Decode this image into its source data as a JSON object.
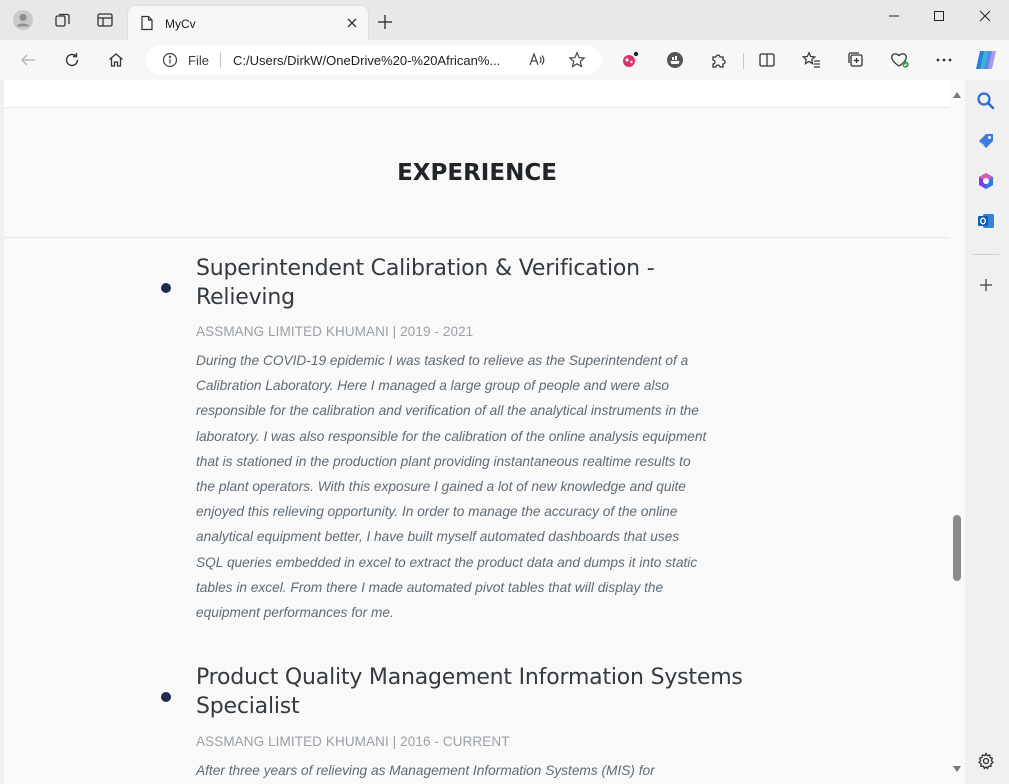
{
  "browser": {
    "tab_title": "MyCv",
    "address_scheme": "File",
    "address_url": "C:/Users/DirkW/OneDrive%20-%20African%...",
    "accent_color": "#1e2a4f"
  },
  "page": {
    "section_heading": "EXPERIENCE",
    "jobs": [
      {
        "title": "Superintendent Calibration & Verification - Relieving",
        "meta": "ASSMANG LIMITED KHUMANI | 2019 - 2021",
        "description": "During the COVID-19 epidemic I was tasked to relieve as the Superintendent of a Calibration Laboratory. Here I managed a large group of people and were also responsible for the calibration and verification of all the analytical instruments in the laboratory. I was also responsible for the calibration of the online analysis equipment that is stationed in the production plant providing instantaneous realtime results to the plant operators. With this exposure I gained a lot of new knowledge and quite enjoyed this relieving opportunity. In order to manage the accuracy of the online analytical equipment better, I have built myself automated dashboards that uses SQL queries embedded in excel to extract the product data and dumps it into static tables in excel. From there I made automated pivot tables that will display the equipment performances for me."
      },
      {
        "title": "Product Quality Management Information Systems Specialist",
        "meta": "ASSMANG LIMITED KHUMANI | 2016 - CURRENT",
        "description": "After three years of relieving as Management Information Systems (MIS) for"
      }
    ]
  },
  "icons": {
    "profile": "profile-icon",
    "workspaces": "workspaces-icon",
    "tab_actions": "tab-actions-icon",
    "page": "page-icon",
    "close": "close-icon",
    "new_tab": "plus-icon",
    "minimize": "minimize-icon",
    "maximize": "maximize-icon",
    "window_close": "window-close-icon",
    "back": "back-arrow-icon",
    "refresh": "refresh-icon",
    "home": "home-icon",
    "info": "info-icon",
    "read_aloud": "read-aloud-icon",
    "favorite": "star-icon",
    "extensions": "puzzle-icon",
    "split": "split-screen-icon",
    "favorites": "favorites-icon",
    "collections": "collections-icon",
    "performance": "heart-icon",
    "more": "more-icon",
    "copilot": "copilot-icon",
    "search": "search-icon",
    "shopping": "tag-icon",
    "office": "office-icon",
    "outlook": "outlook-icon",
    "add": "plus-icon",
    "settings": "gear-icon"
  }
}
